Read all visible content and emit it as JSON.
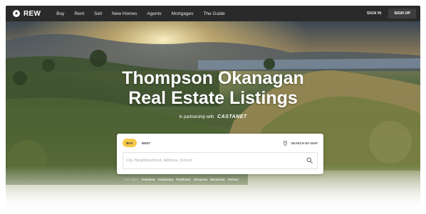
{
  "brand": {
    "name": "REW"
  },
  "nav": {
    "links": [
      "Buy",
      "Rent",
      "Sell",
      "New Homes",
      "Agents",
      "Mortgages",
      "The Guide"
    ],
    "signin": "SIGN IN",
    "signup": "SIGN UP"
  },
  "hero": {
    "title_line1": "Thompson Okanagan",
    "title_line2": "Real Estate Listings",
    "partner_prefix": "In partnership with",
    "partner_name": "CASTANET"
  },
  "search": {
    "tab_buy": "BUY",
    "tab_rent": "RENT",
    "map_label": "SEARCH BY MAP",
    "placeholder": "City, Neighbourhood, Address, School",
    "value": ""
  },
  "top_cities": {
    "label": "Top Cities:",
    "cities": [
      "Kelowna",
      "Kamloops",
      "Penticton",
      "Osoyoos",
      "Naramata",
      "Vernon"
    ]
  },
  "colors": {
    "nav_bg": "#2a2a2a",
    "accent_yellow": "#f6c94a"
  }
}
